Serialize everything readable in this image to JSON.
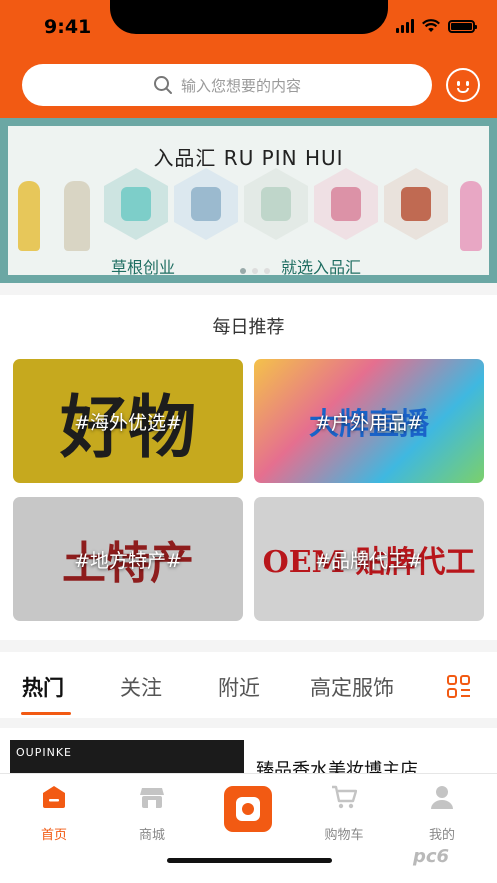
{
  "status_bar": {
    "time": "9:41"
  },
  "search": {
    "placeholder": "输入您想要的内容"
  },
  "banner": {
    "title": "入品汇 RU PIN HUI",
    "left_slogan": "草根创业",
    "right_slogan": "就选入品汇"
  },
  "daily": {
    "title": "每日推荐",
    "cards": [
      {
        "art_text": "好物",
        "tag": "#海外优选#"
      },
      {
        "art_text": "大牌直播",
        "tag": "#户外用品#"
      },
      {
        "art_text": "土特产",
        "tag": "#地方特产#"
      },
      {
        "art_text": "OEM 贴牌代工",
        "tag": "#品牌代工#"
      }
    ]
  },
  "tabs": [
    "热门",
    "关注",
    "附近",
    "高定服饰"
  ],
  "feed": {
    "brand": "OUPINKE",
    "title": "臻品香水美妆博主店"
  },
  "bottom_nav": [
    "首页",
    "商城",
    "购物车",
    "我的"
  ],
  "colors": {
    "accent": "#f25a13"
  },
  "watermark": "pc6"
}
